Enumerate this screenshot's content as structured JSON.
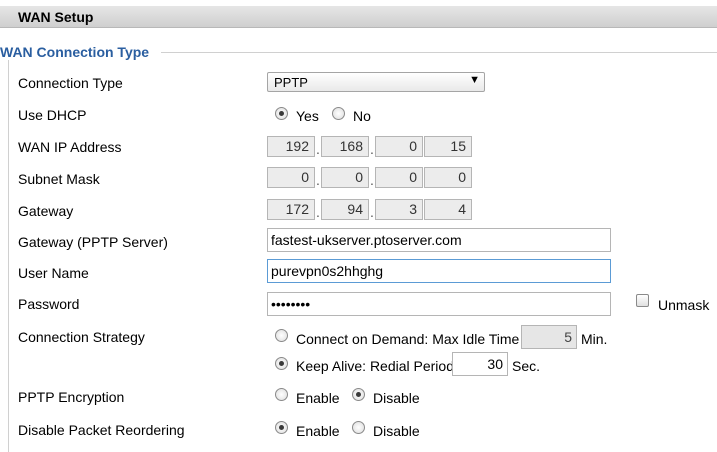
{
  "header": {
    "title": "WAN Setup"
  },
  "section": {
    "legend": "WAN Connection Type"
  },
  "labels": {
    "connection_type": "Connection Type",
    "use_dhcp": "Use DHCP",
    "wan_ip": "WAN IP Address",
    "subnet_mask": "Subnet Mask",
    "gateway": "Gateway",
    "gateway_pptp": "Gateway (PPTP Server)",
    "user_name": "User Name",
    "password": "Password",
    "connection_strategy": "Connection Strategy",
    "pptp_encryption": "PPTP Encryption",
    "disable_packet_reordering": "Disable Packet Reordering"
  },
  "connection_type": {
    "selected": "PPTP"
  },
  "dhcp": {
    "yes": "Yes",
    "no": "No",
    "selected": "Yes"
  },
  "wan_ip": [
    "192",
    "168",
    "0",
    "15"
  ],
  "subnet_mask": [
    "0",
    "0",
    "0",
    "0"
  ],
  "gateway": [
    "172",
    "94",
    "3",
    "4"
  ],
  "gateway_pptp": {
    "value": "fastest-ukserver.ptoserver.com"
  },
  "user_name": {
    "value": "purevpn0s2hhghg"
  },
  "password": {
    "value": "••••••••",
    "unmask_label": "Unmask",
    "unmask_checked": false
  },
  "strategy": {
    "on_demand_label": "Connect on Demand: Max Idle Time",
    "on_demand_value": "5",
    "on_demand_unit": "Min.",
    "keep_alive_label": "Keep Alive: Redial Period",
    "keep_alive_value": "30",
    "keep_alive_unit": "Sec.",
    "selected": "keep_alive"
  },
  "encryption": {
    "enable": "Enable",
    "disable": "Disable",
    "selected": "Disable"
  },
  "reordering": {
    "enable": "Enable",
    "disable": "Disable",
    "selected": "Enable"
  },
  "ip_separator": "."
}
